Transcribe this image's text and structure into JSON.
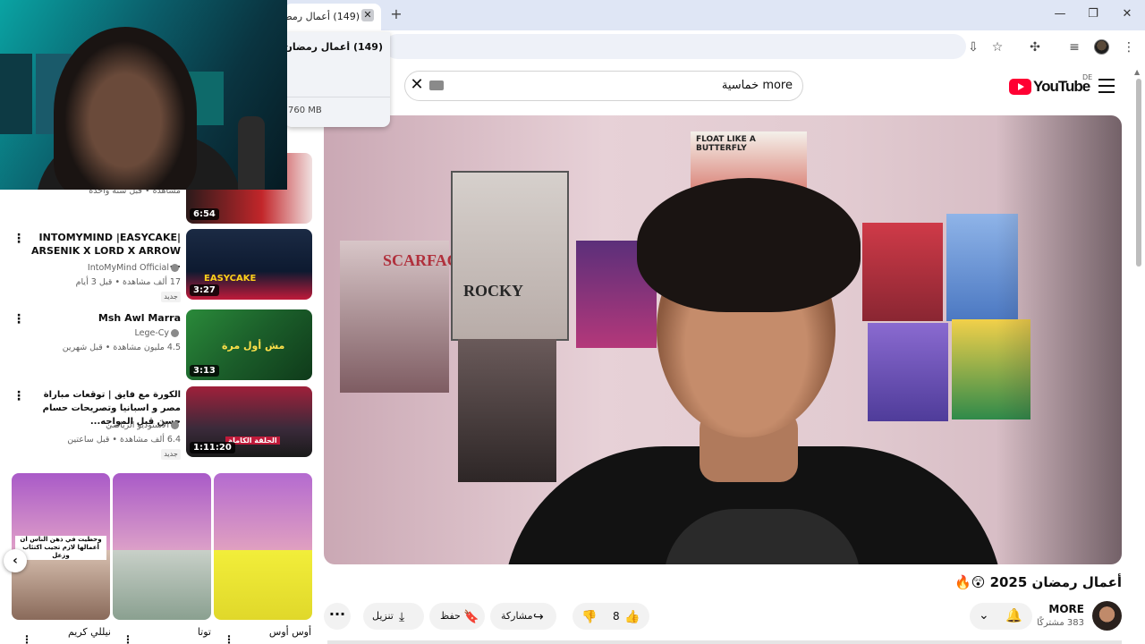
{
  "browser": {
    "tab_title": "(149) أعمال رمضان",
    "close_tab_glyph": "✕",
    "new_tab_glyph": "+",
    "window_controls": [
      "—",
      "❐",
      "✕"
    ],
    "toolbar_icons": [
      "install-icon",
      "star-icon",
      "extensions-icon",
      "media-icon",
      "profile-icon",
      "menu-icon"
    ],
    "tab_popup": {
      "title": "(149) أعمال رمضان",
      "memory": "760 MB"
    }
  },
  "youtube": {
    "logo_text": "YouTube",
    "region": "DE",
    "search_value": "more خماسية",
    "clear_glyph": "✕",
    "accent_color": "#ff0033",
    "video": {
      "title": "أعمال رمضان 2025 😲🔥",
      "channel_name": "MORE",
      "subscribers": "383 مشتركًا",
      "likes": "8",
      "share_label": "مشاركة",
      "save_label": "حفظ",
      "download_label": "تنزيل",
      "poster_texts": [
        "SCARFACE",
        "ROCKY",
        "FLOAT LIKE A BUTTERFLY"
      ]
    },
    "recommendations": [
      {
        "title": "",
        "channel": "",
        "meta": "مشاهدة • قبل سنة واحدة",
        "duration": "6:54",
        "badge": ""
      },
      {
        "title": "INTOMYMIND |EASYCAKE| ARSENIK X LORD X ARROW ...",
        "channel": "IntoMyMind Official",
        "meta": "17 ألف مشاهدة • قبل 3 أيام",
        "duration": "3:27",
        "badge": "جديد",
        "thumb_text": "EASYCAKE"
      },
      {
        "title": "Msh Awl Marra",
        "channel": "Lege-Cy",
        "meta": "4.5 مليون مشاهدة • قبل شهرين",
        "duration": "3:13",
        "badge": "",
        "thumb_text": "مش أول مرة"
      },
      {
        "title": "الكورة مع فايق | توقعات مباراة مصر و اسبانيا وتصريحات حسام حسن قبل المواجه...",
        "channel": "الأستوديو الرياضي",
        "meta": "6.4 ألف مشاهدة • قبل ساعتين",
        "duration": "1:11:20",
        "badge": "جديد",
        "thumb_text": "الحلقة الكاملة"
      }
    ],
    "shorts": [
      {
        "name": "أوس أوس",
        "caption": ""
      },
      {
        "name": "توتا",
        "caption": ""
      },
      {
        "name": "نيللي كريم",
        "caption": "وحطيت في ذهن الناس ان أعمالها لازم تجيب اكتئاب وزعل"
      }
    ],
    "dots_glyph": "⋮",
    "nav_left_glyph": "‹"
  }
}
